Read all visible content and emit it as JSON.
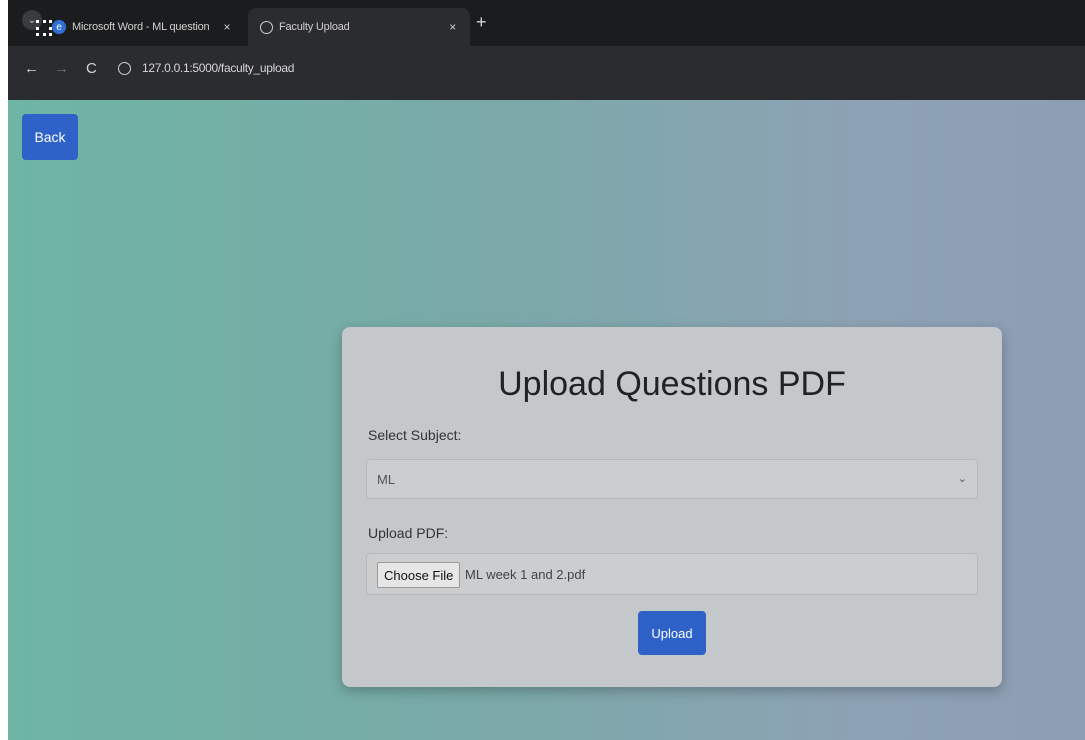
{
  "browser": {
    "tabs": [
      {
        "title": "Microsoft Word - ML question",
        "close": "×"
      },
      {
        "title": "Faculty Upload",
        "close": "×"
      }
    ],
    "new_tab": "+",
    "address": "127.0.0.1:5000/faculty_upload",
    "icons": {
      "back": "←",
      "forward": "→",
      "reload": "C"
    }
  },
  "page": {
    "back_label": "Back",
    "title": "Upload Questions PDF",
    "subject_label": "Select Subject:",
    "subject_value": "ML",
    "pdf_label": "Upload PDF:",
    "choose_file_label": "Choose File",
    "file_name": "ML week 1 and 2.pdf",
    "upload_label": "Upload"
  },
  "colors": {
    "primary_button": "#2e62c9",
    "card": "#c4c8cb",
    "gradient_start": "#6eb5a5",
    "gradient_end": "#8c9eb3"
  }
}
